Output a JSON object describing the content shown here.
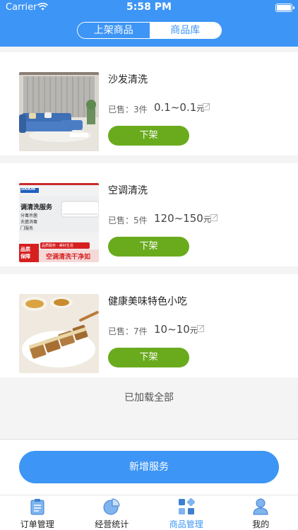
{
  "status_bar": {
    "carrier": "Carrier",
    "time": "5:58 PM"
  },
  "segment": {
    "tabs": [
      {
        "label": "上架商品",
        "active": false
      },
      {
        "label": "商品库",
        "active": true
      }
    ]
  },
  "products": [
    {
      "name": "沙发清洗",
      "sold_label": "已售：3件",
      "price": "0.1~0.1",
      "unit": "元",
      "action": "下架"
    },
    {
      "name": "空调清洗",
      "sold_label": "已售：5件",
      "price": "120~150",
      "unit": "元",
      "action": "下架"
    },
    {
      "name": "健康美味特色小吃",
      "sold_label": "已售：7件",
      "price": "10~10",
      "unit": "元",
      "action": "下架"
    }
  ],
  "ac_banner": {
    "brand": "DAIKIN",
    "title": "调清洗服务",
    "lines": [
      "分毒杀菌",
      "夫菌消毒",
      "门服务"
    ],
    "badge_top": "品质服务 · 美好生活",
    "badge_left": [
      "品质",
      "保障"
    ],
    "slogan": "空调清洗干净如"
  },
  "list_footer": "已加载全部",
  "add_button": "新增服务",
  "tabbar": [
    {
      "label": "订单管理",
      "icon": "clipboard-icon",
      "active": false
    },
    {
      "label": "经营统计",
      "icon": "pie-chart-icon",
      "active": false
    },
    {
      "label": "商品管理",
      "icon": "grid-icon",
      "active": true
    },
    {
      "label": "我的",
      "icon": "person-icon",
      "active": false
    }
  ],
  "colors": {
    "primary": "#3d95f5",
    "action_green": "#6aab1e"
  }
}
